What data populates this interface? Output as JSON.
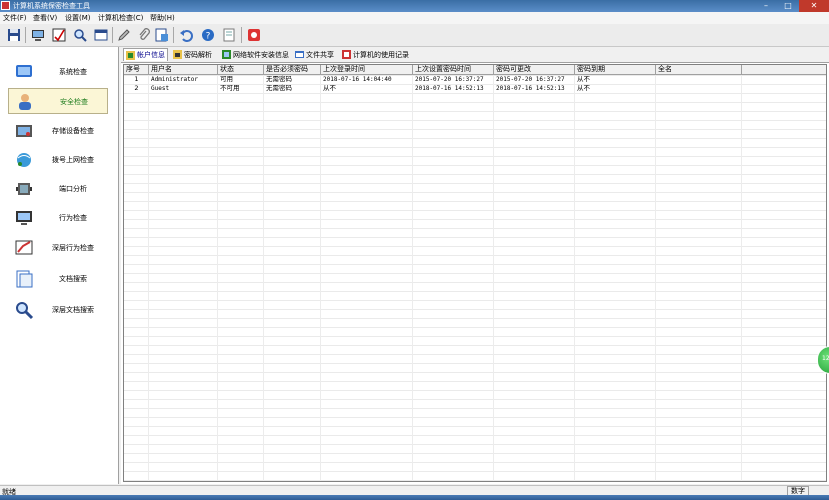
{
  "window": {
    "title": "计算机系统保密检查工具"
  },
  "menu": [
    "文件(F)",
    "查看(V)",
    "设置(M)",
    "计算机检查(C)",
    "帮助(H)"
  ],
  "toolbar": {
    "icons": [
      "save-icon",
      "computer-icon",
      "checklist-icon",
      "magnifier-icon",
      "window-icon",
      "pencil-icon",
      "paperclip-icon",
      "report-icon",
      "undo-icon",
      "help-icon",
      "document-icon",
      "settings-icon"
    ]
  },
  "sidebar": {
    "items": [
      {
        "label": "系统检查",
        "icon": "system-check-icon"
      },
      {
        "label": "安全检查",
        "icon": "security-check-icon",
        "active": true
      },
      {
        "label": "存储设备检查",
        "icon": "storage-device-icon"
      },
      {
        "label": "拨号上网检查",
        "icon": "dialup-icon"
      },
      {
        "label": "端口分析",
        "icon": "port-icon"
      },
      {
        "label": "行为检查",
        "icon": "behavior-monitor-icon"
      },
      {
        "label": "深层行为检查",
        "icon": "deep-behavior-icon"
      },
      {
        "label": "文档搜索",
        "icon": "document-search-icon"
      },
      {
        "label": "深层文档搜索",
        "icon": "deep-document-search-icon"
      }
    ]
  },
  "tabs": [
    {
      "label": "帐户信息",
      "active": true
    },
    {
      "label": "密码解析"
    },
    {
      "label": "网络软件安装信息"
    },
    {
      "label": "文件共享"
    },
    {
      "label": "计算机的使用记录"
    }
  ],
  "table": {
    "headers": [
      "序号",
      "用户名",
      "状态",
      "是否必须密码",
      "上次登录时间",
      "上次设置密码时间",
      "密码可更改",
      "密码到期",
      "全名"
    ],
    "rows": [
      [
        "1",
        "Administrator",
        "可用",
        "无需密码",
        "2018-07-16 14:04:40",
        "2015-07-20 16:37:27",
        "2015-07-20 16:37:27",
        "从不",
        ""
      ],
      [
        "2",
        "Guest",
        "不可用",
        "无需密码",
        "从不",
        "2018-07-16 14:52:13",
        "2018-07-16 14:52:13",
        "从不",
        ""
      ]
    ]
  },
  "status": {
    "left": "就绪",
    "right": "数字"
  },
  "float_button": {
    "label": "12"
  }
}
